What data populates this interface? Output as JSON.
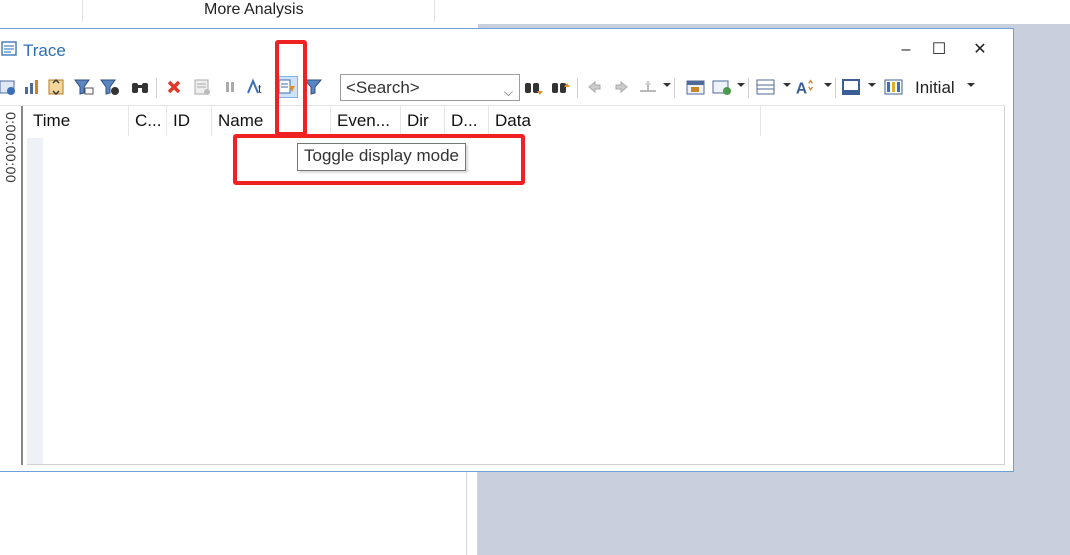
{
  "top_tab": {
    "label": "More Analysis"
  },
  "window": {
    "title": "Trace",
    "minimize": "–",
    "maximize": "☐",
    "close": "✕"
  },
  "toolbar": {
    "search_placeholder": "<Search>",
    "display_profile": "Initial"
  },
  "time_strip": {
    "label": "0:00:00:00"
  },
  "columns": [
    "Time",
    "C...",
    "ID",
    "Name",
    "",
    "Even...",
    "Dir",
    "D...",
    "Data"
  ],
  "tooltip": {
    "text": "Toggle display mode"
  },
  "colors": {
    "highlight": "#ee2222",
    "title": "#2f6fb9",
    "accent_background": "#c8d0de"
  }
}
